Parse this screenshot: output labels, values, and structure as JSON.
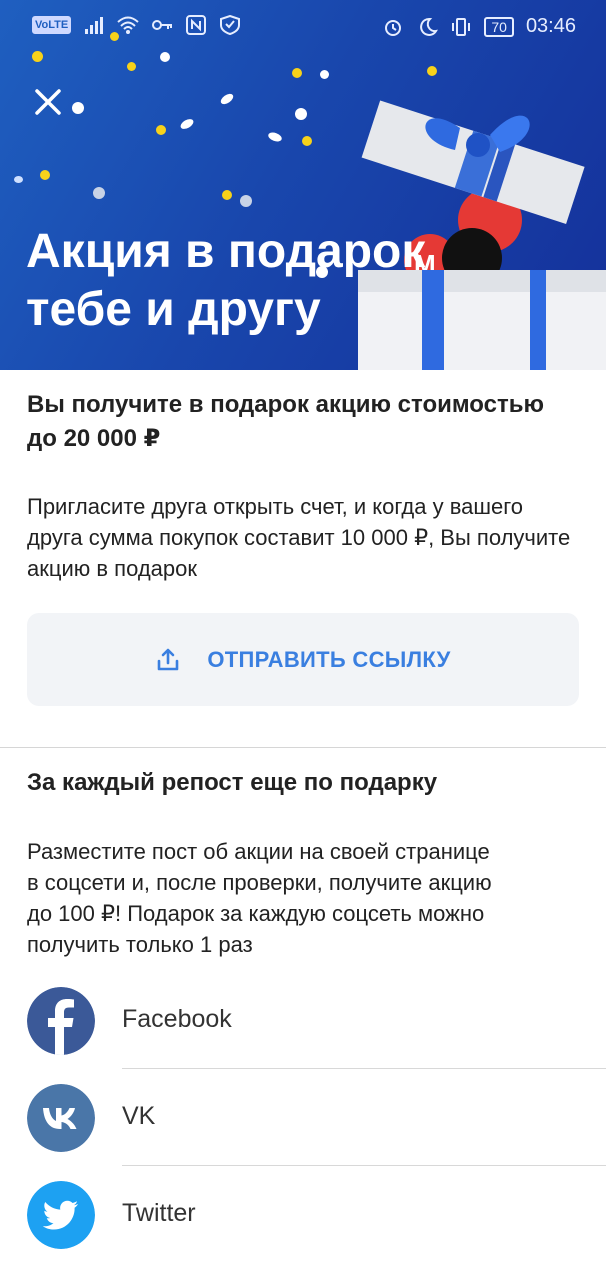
{
  "status_bar": {
    "volte": "VoLTE",
    "battery": "70",
    "time": "03:46",
    "icons": [
      "volte-icon",
      "signal-icon",
      "wifi-icon",
      "key-icon",
      "nfc-icon",
      "shield-icon",
      "alarm-icon",
      "moon-icon",
      "vibrate-icon",
      "battery-icon"
    ]
  },
  "hero": {
    "title_line1": "Акция в подарок",
    "title_line2": "тебе и другу",
    "close_icon": "close-icon",
    "colors": {
      "bg_start": "#1f5fc0",
      "bg_end": "#14309a",
      "confetti_yellow": "#f7d21a",
      "confetti_white": "#ffffff"
    }
  },
  "invite": {
    "heading": "Вы получите в подарок акцию стоимостью до 20 000 ₽",
    "text": "Пригласите друга открыть счет, и когда у вашего друга сумма покупок составит 10 000 ₽, Вы получите акцию в подарок",
    "button_label": "ОТПРАВИТЬ ССЫЛКУ",
    "button_icon": "share-icon",
    "accent": "#3a7fe0"
  },
  "repost": {
    "heading": "За каждый репост еще по подарку",
    "text_line1": "Разместите пост об акции на своей странице",
    "text_line2": "в соцсети и, после проверки, получите акцию",
    "text_line3": "до 100 ₽! Подарок за каждую соцсеть можно",
    "text_line4": "получить только 1 раз"
  },
  "social": [
    {
      "label": "Facebook",
      "icon": "facebook-icon",
      "color": "#3b5998"
    },
    {
      "label": "VK",
      "icon": "vk-icon",
      "color": "#4a76a8"
    },
    {
      "label": "Twitter",
      "icon": "twitter-icon",
      "color": "#1da1f2"
    }
  ]
}
